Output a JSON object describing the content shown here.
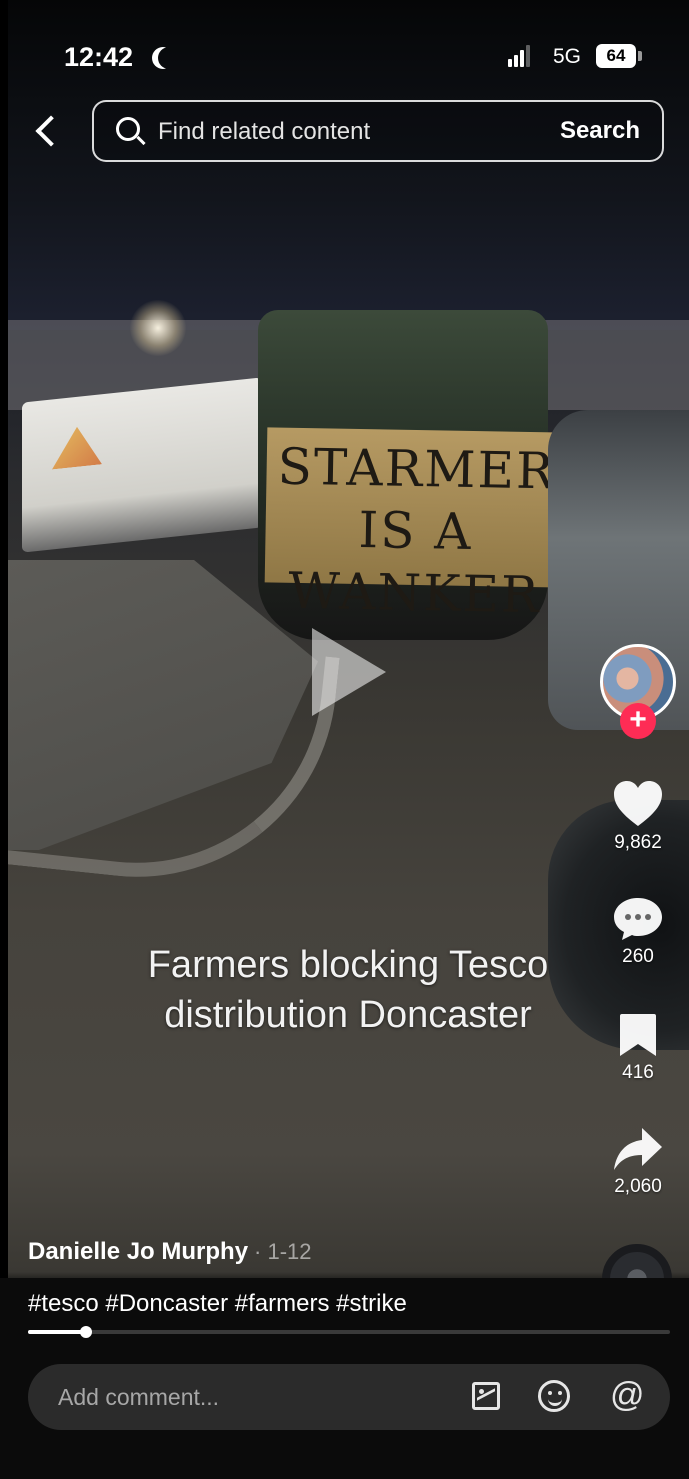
{
  "status_bar": {
    "time": "12:42",
    "network": "5G",
    "battery": "64"
  },
  "search": {
    "placeholder": "Find related content",
    "button_label": "Search"
  },
  "video": {
    "sign_text": "STARMER IS A WANKER",
    "caption": "Farmers blocking Tesco distribution Doncaster"
  },
  "actions": {
    "likes": "9,862",
    "comments": "260",
    "saves": "416",
    "shares": "2,060"
  },
  "post": {
    "author": "Danielle Jo Murphy",
    "date": "· 1-12",
    "hashtags": "#tesco #Doncaster #farmers #strike",
    "progress": 0.09
  },
  "comment_bar": {
    "placeholder": "Add comment..."
  },
  "colors": {
    "follow": "#fe2c55",
    "background": "#000000"
  },
  "icons": [
    "back-icon",
    "search-icon",
    "play-icon",
    "heart-icon",
    "comment-icon",
    "bookmark-icon",
    "share-icon",
    "image-icon",
    "emoji-icon",
    "mention-icon"
  ]
}
